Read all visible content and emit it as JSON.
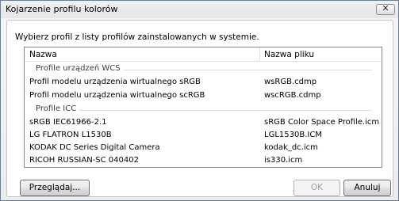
{
  "window": {
    "title": "Kojarzenie profilu kolorów",
    "close_glyph": "✕"
  },
  "instruction": "Wybierz profil z listy profilów zainstalowanych w systemie.",
  "list": {
    "columns": [
      "Nazwa",
      "Nazwa pliku"
    ],
    "groups": [
      {
        "label": "Profile urządzeń WCS",
        "rows": [
          {
            "name": "Profil modelu urządzenia wirtualnego sRGB",
            "file": "wsRGB.cdmp"
          },
          {
            "name": "Profil modelu urządzenia wirtualnego scRGB",
            "file": "wscRGB.cdmp"
          }
        ]
      },
      {
        "label": "Profile ICC",
        "rows": [
          {
            "name": "sRGB IEC61966-2.1",
            "file": "sRGB Color Space Profile.icm"
          },
          {
            "name": "LG FLATRON L1530B",
            "file": "LGL1530B.ICM"
          },
          {
            "name": "KODAK DC Series Digital Camera",
            "file": "kodak_dc.icm"
          },
          {
            "name": "RICOH RUSSIAN-SC 040402",
            "file": "is330.icm"
          }
        ]
      }
    ]
  },
  "buttons": {
    "browse": "Przeglądaj...",
    "ok": "OK",
    "cancel": "Anuluj"
  }
}
